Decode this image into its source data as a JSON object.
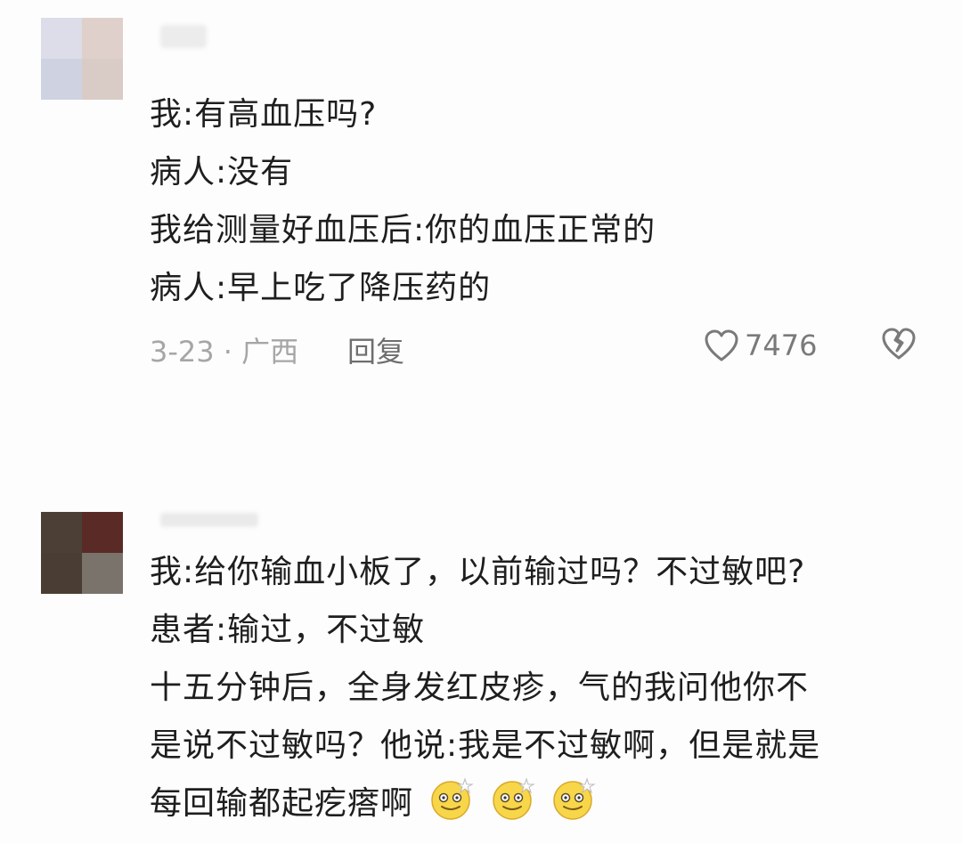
{
  "comments": [
    {
      "lines": [
        "我:有高血压吗?",
        "病人:没有",
        "我给测量好血压后:你的血压正常的",
        "病人:早上吃了降压药的"
      ],
      "date_location": "3-23 · 广西",
      "reply_label": "回复",
      "likes": "7476"
    },
    {
      "lines": [
        "我:给你输血小板了，以前输过吗？不过敏吧?",
        "患者:输过，不过敏",
        "十五分钟后，全身发红皮疹，气的我问他你不",
        "是说不过敏吗？他说:我是不过敏啊，但是就是",
        "每回输都起疙瘩啊"
      ],
      "emojis": [
        "dizzy-face-emoji",
        "dizzy-face-emoji",
        "dizzy-face-emoji"
      ]
    }
  ],
  "colors": {
    "text": "#1e1e1e",
    "meta": "#a6a6a6",
    "reply": "#6e6e6e"
  }
}
